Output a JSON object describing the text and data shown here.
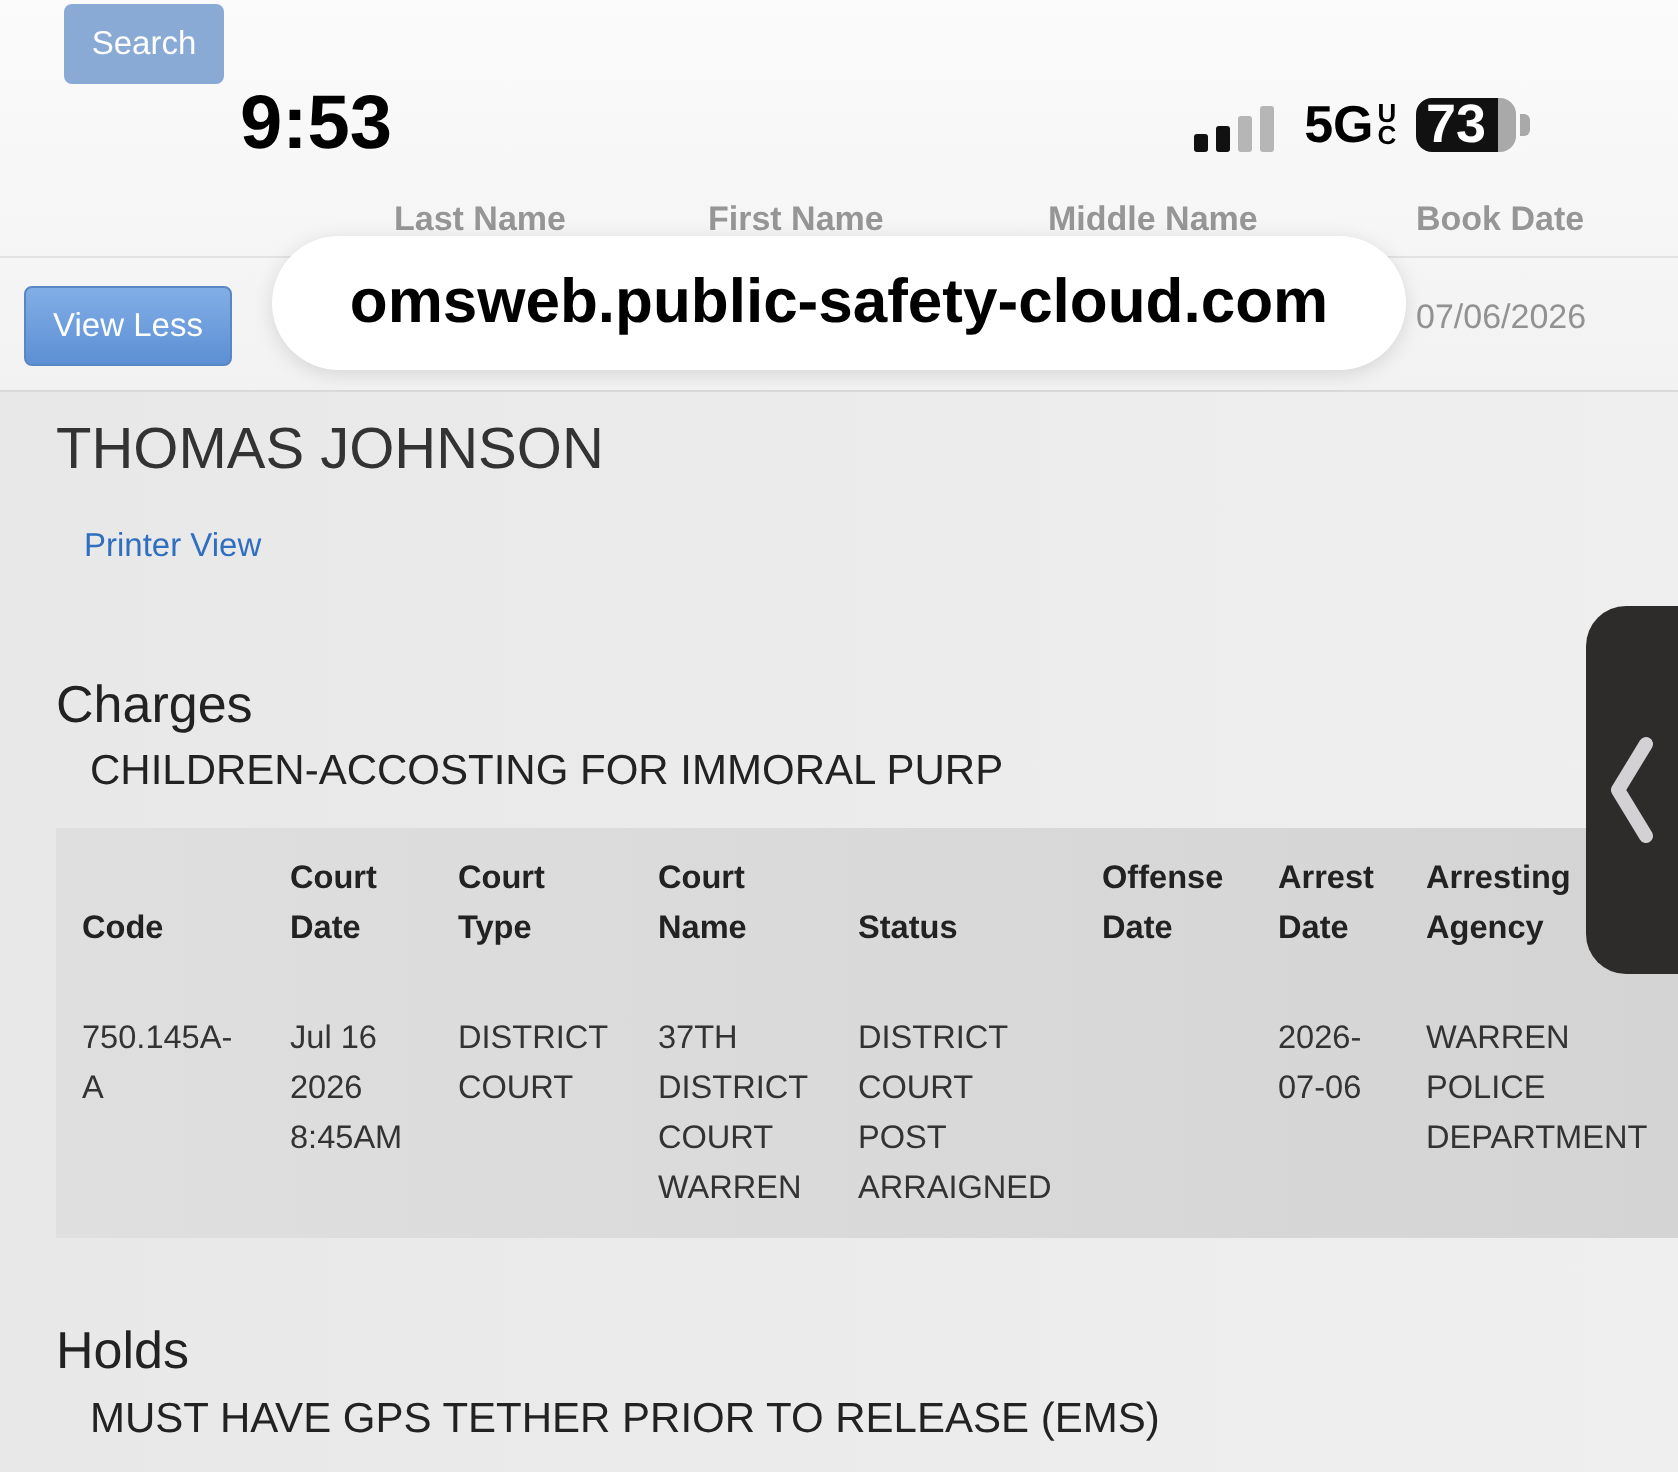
{
  "search_button": {
    "label": "Search"
  },
  "status_bar": {
    "time": "9:53",
    "network": "5G",
    "network_badge": "UC",
    "battery": "73"
  },
  "address_bar": {
    "url": "omsweb.public-safety-cloud.com"
  },
  "results_table": {
    "columns": [
      "Last Name",
      "First Name",
      "Middle Name",
      "Book Date"
    ],
    "row": {
      "button": "View Less",
      "book_date": "07/06/2026"
    }
  },
  "inmate": {
    "name": "THOMAS JOHNSON",
    "printer_view_link": "Printer View"
  },
  "charges": {
    "title": "Charges",
    "description": "CHILDREN-ACCOSTING FOR IMMORAL PURP",
    "table": {
      "columns": [
        "Code",
        "Court Date",
        "Court Type",
        "Court Name",
        "Status",
        "Offense Date",
        "Arrest Date",
        "Arresting Agency"
      ],
      "rows": [
        {
          "cells": [
            "750.145A-A",
            "Jul 16 2026 8:45AM",
            "DISTRICT COURT",
            "37TH DISTRICT COURT WARREN",
            "DISTRICT COURT POST ARRAIGNED",
            null,
            "2026-07-06",
            "WARREN POLICE DEPARTMENT"
          ]
        }
      ]
    }
  },
  "holds": {
    "title": "Holds",
    "items": [
      "MUST HAVE GPS TETHER PRIOR TO RELEASE (EMS)"
    ]
  }
}
